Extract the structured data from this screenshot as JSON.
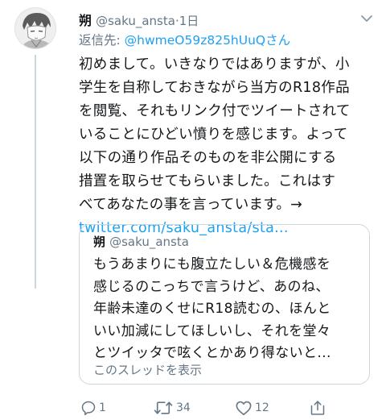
{
  "tweet": {
    "display_name": "朔",
    "handle": "@saku_ansta",
    "separator": "·",
    "time": "1日",
    "reply_prefix": "返信先: ",
    "reply_mention": "@hwmeO59z825hUuQ",
    "reply_suffix": "さん",
    "body_lines": [
      "初めまして。いきなりではありますが、小",
      "学生を自称しておきながら当方のR18作品",
      "を閲覧、それもリンク付でツイートされて",
      "いることにひどい憤りを感じます。よって",
      "以下の通り作品そのものを非公開にする",
      "措置を取らせてもらいました。これはす",
      "べてあなたの事を言っています。→"
    ],
    "link_text": "twitter.com/saku_ansta/sta..."
  },
  "quoted_tweet": {
    "display_name": "朔",
    "handle": "@saku_ansta",
    "lines": [
      "もうあまりにも腹立たしい＆危機感を",
      "感じるのこっちで言うけど、あのね、",
      "年齢未達のくせにR18読むの、ほんと",
      "いい加減にしてほしいし、それを堂々",
      "とツイッタで呟くとかあり得ないと..."
    ],
    "show_thread": "このスレッドを表示"
  },
  "actions": {
    "reply_count": "1",
    "retweet_count": "34",
    "like_count": "12"
  },
  "colors": {
    "link": "#1da1f2",
    "secondary_text": "#657786",
    "icon": "#657786",
    "border": "#ccd6dd"
  }
}
